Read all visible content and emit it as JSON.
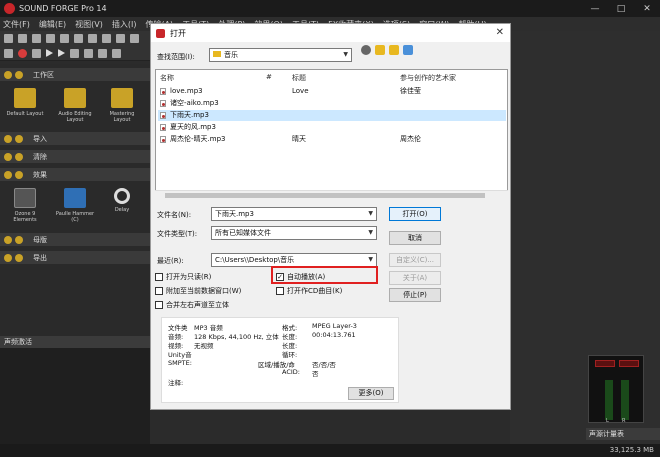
{
  "app": {
    "title": "SOUND FORGE Pro 14",
    "menu": [
      "文件(F)",
      "编辑(E)",
      "视图(V)",
      "插入(I)",
      "传输(A)",
      "工具(T)",
      "处理(P)",
      "效果(O)",
      "工具(T)",
      "FX收藏夹(X)",
      "选项(S)",
      "窗口(W)",
      "帮助(H)"
    ],
    "window_controls": {
      "minimize": "—",
      "maximize": "□",
      "close": "✕"
    },
    "status_text": "33,125.3 MB"
  },
  "left_panel": {
    "sections": {
      "workspace": "工作区",
      "import": "导入",
      "clean": "清除",
      "effects": "效果",
      "mastering": "母版",
      "export": "导出"
    },
    "workspace_tiles": [
      {
        "label": "Default Layout"
      },
      {
        "label": "Audio Editing Layout"
      },
      {
        "label": "Mastering Layout"
      }
    ],
    "effect_tiles": [
      {
        "label": "Ozone 9 Elements"
      },
      {
        "label": "Paulle Hammer (C)"
      },
      {
        "label": "Delay"
      }
    ],
    "bottom_header": "声频激活"
  },
  "right_panel": {
    "meter_labels": [
      "L",
      "R"
    ],
    "bottom_header": "声源计量表"
  },
  "dialog": {
    "title": "打开",
    "close": "✕",
    "look_in_label": "查找范围(I):",
    "look_in_value": "音乐",
    "columns": [
      "名称",
      "#",
      "标题",
      "参与创作的艺术家"
    ],
    "files": [
      {
        "name": "love.mp3",
        "num": "",
        "title": "Love",
        "artist": "徐佳莹",
        "selected": false
      },
      {
        "name": "诸空-aiko.mp3",
        "num": "",
        "title": "",
        "artist": "",
        "selected": false
      },
      {
        "name": "下雨天.mp3",
        "num": "",
        "title": "",
        "artist": "",
        "selected": true
      },
      {
        "name": "夏天的风.mp3",
        "num": "",
        "title": "",
        "artist": "",
        "selected": false
      },
      {
        "name": "周杰伦-晴天.mp3",
        "num": "",
        "title": "晴天",
        "artist": "周杰伦",
        "selected": false
      }
    ],
    "filename_label": "文件名(N):",
    "filename_value": "下雨天.mp3",
    "filetype_label": "文件类型(T):",
    "filetype_value": "所有已知媒体文件",
    "recent_label": "最近(R):",
    "recent_value": "C:\\Users\\\\Desktop\\音乐",
    "buttons": {
      "open": "打开(O)",
      "cancel": "取消",
      "custom": "自定义(C)...",
      "about": "关于(A)",
      "stop": "停止(P)",
      "more": "更多(O)"
    },
    "checkboxes": {
      "readonly": {
        "label": "打开为只读(R)",
        "checked": false
      },
      "autoplay": {
        "label": "自动播放(A)",
        "checked": true
      },
      "append": {
        "label": "附加至当前数据窗口(W)",
        "checked": false
      },
      "open_cd": {
        "label": "打开作CD曲目(K)",
        "checked": false
      },
      "merge": {
        "label": "合并左右声道至立体",
        "checked": false
      }
    },
    "info_left": [
      {
        "k": "文件类",
        "v": "MP3 音频"
      },
      {
        "k": "音频:",
        "v": "128 Kbps, 44,100 Hz, 立体"
      },
      {
        "k": "视频:",
        "v": "无视频"
      },
      {
        "k": "Unity音",
        "v": ""
      },
      {
        "k": "SMPTE:",
        "v": ""
      },
      {
        "k": "注释:",
        "v": ""
      }
    ],
    "info_right": [
      {
        "k": "格式:",
        "v": "MPEG Layer-3"
      },
      {
        "k": "长度:",
        "v": "00:04:13.761"
      },
      {
        "k": "长度:",
        "v": ""
      },
      {
        "k": "循环:",
        "v": ""
      },
      {
        "k": "区域/播放/命",
        "v": "否/否/否"
      },
      {
        "k": "ACID:",
        "v": "否"
      }
    ]
  }
}
